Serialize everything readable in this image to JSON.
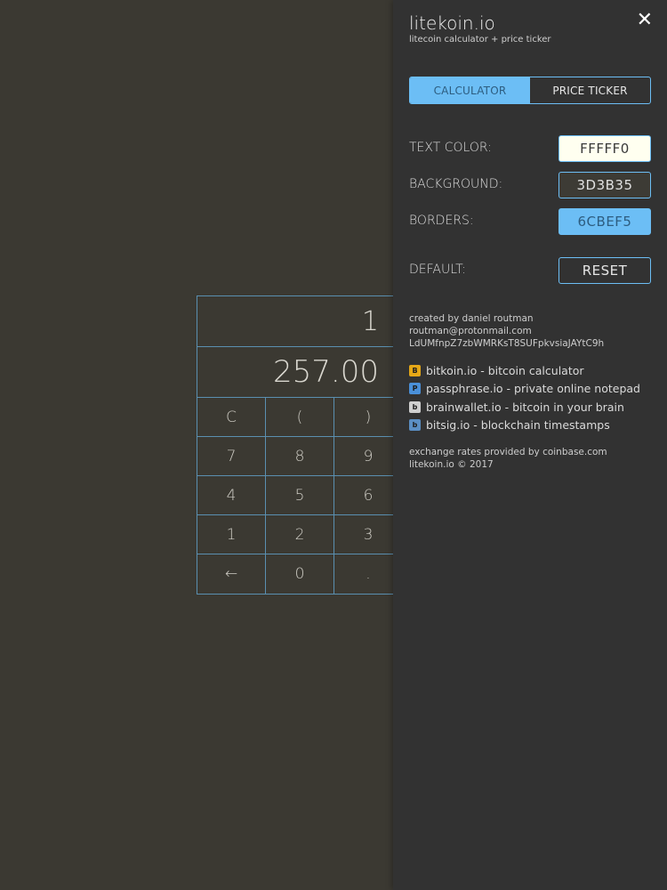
{
  "calculator": {
    "display_amount": "1",
    "display_result": "257.00",
    "keys": [
      [
        "C",
        "(",
        ")"
      ],
      [
        "7",
        "8",
        "9"
      ],
      [
        "4",
        "5",
        "6"
      ],
      [
        "1",
        "2",
        "3"
      ],
      [
        "←",
        "0",
        "."
      ]
    ]
  },
  "panel": {
    "title": "litekoin.io",
    "subtitle": "litecoin calculator + price ticker",
    "close_glyph": "✕",
    "tabs": [
      {
        "label": "CALCULATOR",
        "active": true
      },
      {
        "label": "PRICE TICKER",
        "active": false
      }
    ],
    "settings": {
      "text_color_label": "TEXT COLOR:",
      "text_color_value": "FFFFF0",
      "background_label": "BACKGROUND:",
      "background_value": "3D3B35",
      "borders_label": "BORDERS:",
      "borders_value": "6CBEF5",
      "default_label": "DEFAULT:",
      "reset_label": "RESET"
    },
    "credits": {
      "created_by": "created by daniel routman",
      "email": "routman@protonmail.com",
      "address": "LdUMfnpZ7zbWMRKsT8SUFpkvsiaJAYtC9h"
    },
    "links": [
      {
        "icon": "B",
        "icon_color": "#e6a817",
        "text": "bitkoin.io - bitcoin calculator"
      },
      {
        "icon": "P",
        "icon_color": "#4a90d9",
        "text": "passphrase.io - private online notepad"
      },
      {
        "icon": "b",
        "icon_color": "#d0d0d0",
        "text": "brainwallet.io - bitcoin in your brain"
      },
      {
        "icon": "b",
        "icon_color": "#5b8fc4",
        "text": "bitsig.io - blockchain timestamps"
      }
    ],
    "footer": {
      "rates": "exchange rates provided by coinbase.com",
      "copyright": "litekoin.io © 2017"
    }
  },
  "colors": {
    "page_background": "#3d3b35",
    "panel_background": "#323232",
    "accent": "#6cbef5",
    "text_color": "#fffff0"
  }
}
